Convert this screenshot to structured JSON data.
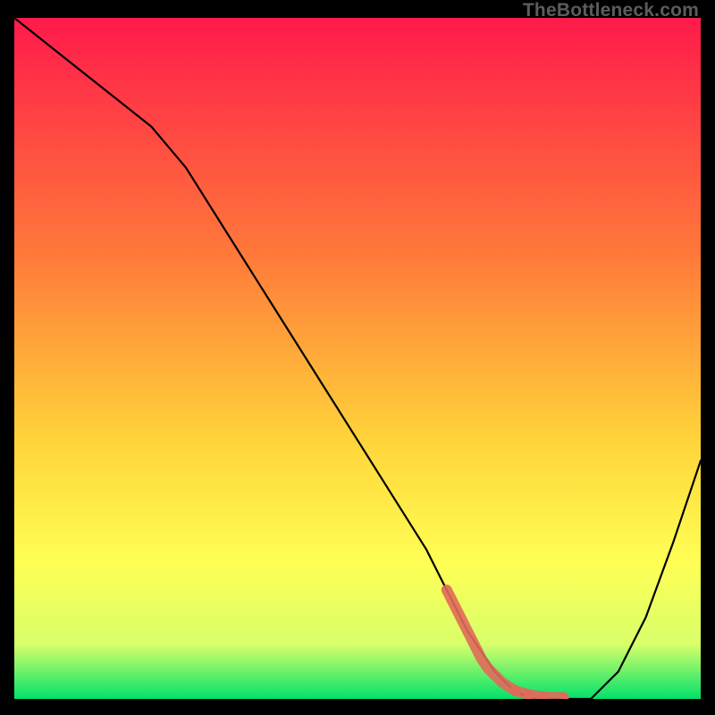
{
  "watermark": "TheBottleneck.com",
  "colors": {
    "frame": "#000000",
    "gradient_top": "#ff1a4b",
    "gradient_mid1": "#ff7a3a",
    "gradient_mid2": "#ffd43a",
    "gradient_mid3": "#ffff55",
    "gradient_mid4": "#d8ff6a",
    "gradient_bottom": "#00e26a",
    "curve": "#000000",
    "marker": "#e06a5a"
  },
  "chart_data": {
    "type": "line",
    "title": "",
    "xlabel": "",
    "ylabel": "",
    "xlim": [
      0,
      100
    ],
    "ylim": [
      0,
      100
    ],
    "grid": false,
    "legend": false,
    "series": [
      {
        "name": "bottleneck-curve",
        "x": [
          0,
          5,
          10,
          15,
          20,
          25,
          30,
          35,
          40,
          45,
          50,
          55,
          60,
          63,
          66,
          70,
          73,
          76,
          80,
          84,
          88,
          92,
          96,
          100
        ],
        "y": [
          100,
          96,
          92,
          88,
          84,
          78,
          70,
          62,
          54,
          46,
          38,
          30,
          22,
          16,
          10,
          4,
          1,
          0,
          0,
          0,
          4,
          12,
          23,
          35
        ]
      }
    ],
    "markers": {
      "name": "highlight-dots",
      "color": "#e06a5a",
      "points": [
        {
          "x": 63,
          "y": 16
        },
        {
          "x": 64,
          "y": 14
        },
        {
          "x": 65,
          "y": 12
        },
        {
          "x": 66,
          "y": 10
        },
        {
          "x": 67,
          "y": 8
        },
        {
          "x": 68,
          "y": 6
        },
        {
          "x": 69,
          "y": 4.5
        },
        {
          "x": 70,
          "y": 3.5
        },
        {
          "x": 71,
          "y": 2.5
        },
        {
          "x": 72,
          "y": 1.8
        },
        {
          "x": 73,
          "y": 1.2
        },
        {
          "x": 75,
          "y": 0.6
        },
        {
          "x": 77,
          "y": 0.3
        },
        {
          "x": 80,
          "y": 0.2
        }
      ]
    }
  }
}
